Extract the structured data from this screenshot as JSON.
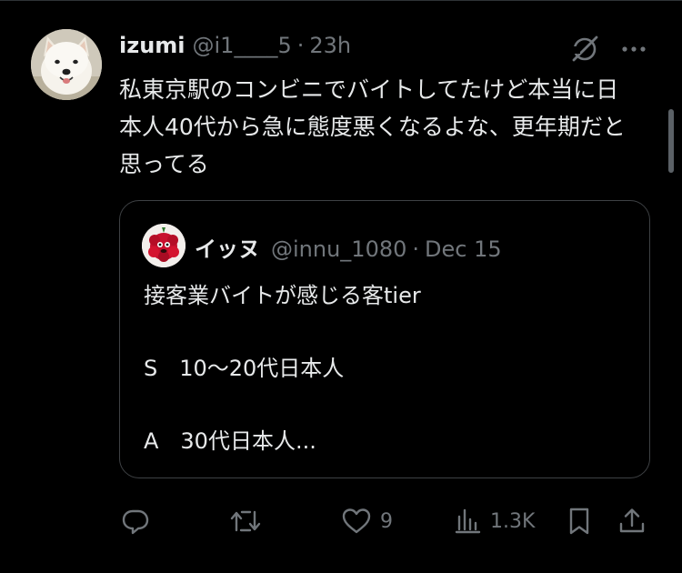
{
  "post": {
    "author_name": "izumi",
    "author_handle": "@i1____5",
    "separator": "·",
    "time": "23h",
    "text": "私東京駅のコンビニでバイトしてたけど本当に日本人40代から急に態度悪くなるよな、更年期だと思ってる"
  },
  "quoted_post": {
    "author_name": "イッヌ",
    "author_handle": "@innu_1080",
    "separator": "·",
    "date": "Dec 15",
    "lines": [
      "接客業バイトが感じる客tier",
      "",
      "S　10〜20代日本人",
      "",
      "A　30代日本人..."
    ]
  },
  "actions": {
    "reply_count": "",
    "repost_count": "",
    "like_count": "9",
    "views_count": "1.3K"
  },
  "icons": {
    "grok": "grok-icon",
    "more": "more-icon",
    "reply": "reply-icon",
    "repost": "repost-icon",
    "like": "heart-icon",
    "views": "views-icon",
    "bookmark": "bookmark-icon",
    "share": "share-icon"
  },
  "colors": {
    "background": "#000000",
    "text_primary": "#e7e9ea",
    "text_secondary": "#71767b",
    "border": "#3e4144"
  }
}
